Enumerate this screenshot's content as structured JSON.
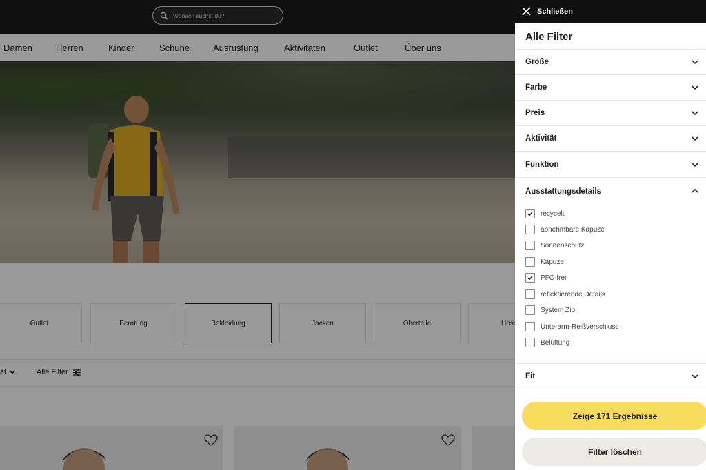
{
  "header": {
    "search_placeholder": "Wonach suchst du?"
  },
  "nav": {
    "items": [
      "Damen",
      "Herren",
      "Kinder",
      "Schuhe",
      "Ausrüstung",
      "Aktivitäten",
      "Outlet",
      "Über uns"
    ]
  },
  "categories": {
    "items": [
      "Outlet",
      "Beratung",
      "Bekleidung",
      "Jacken",
      "Oberteile",
      "Hose"
    ],
    "active": "Bekleidung"
  },
  "toolbar": {
    "sort_label": "ät",
    "all_filters_label": "Alle Filter"
  },
  "drawer": {
    "close_label": "Schließen",
    "title": "Alle Filter",
    "sections": {
      "size": "Größe",
      "color": "Farbe",
      "price": "Preis",
      "activity": "Aktivität",
      "function": "Funktion",
      "features": "Ausstattungsdetails",
      "fit": "Fit"
    },
    "feature_options": [
      {
        "label": "recycelt",
        "checked": true
      },
      {
        "label": "abnehmbare Kapuze",
        "checked": false
      },
      {
        "label": "Sonnenschutz",
        "checked": false
      },
      {
        "label": "Kapuze",
        "checked": false
      },
      {
        "label": "PFC-frei",
        "checked": true
      },
      {
        "label": "reflektierende Details",
        "checked": false
      },
      {
        "label": "System Zip",
        "checked": false
      },
      {
        "label": "Unterarm-Reißverschluss",
        "checked": false
      },
      {
        "label": "Belüftung",
        "checked": false
      }
    ],
    "show_results_label": "Zeige 171 Ergebnisse",
    "clear_filters_label": "Filter löschen"
  },
  "colors": {
    "accent_yellow": "#f9dc5c",
    "secondary_button": "#ecebe3",
    "topbar": "#1b1b1b"
  }
}
